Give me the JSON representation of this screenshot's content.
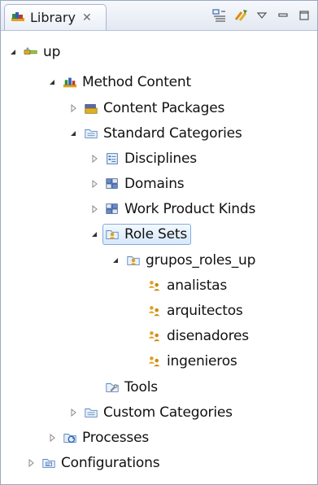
{
  "view": {
    "tab_label": "Library",
    "tab_close_glyph": "✕",
    "toolbar": [
      {
        "name": "link-with-editor-icon"
      },
      {
        "name": "sync-icon"
      },
      {
        "name": "view-menu-icon"
      },
      {
        "name": "minimize-icon"
      },
      {
        "name": "maximize-icon"
      }
    ]
  },
  "tree": {
    "nodes": [
      {
        "label": "up",
        "icon": "plugin-icon",
        "expanded": true
      },
      {
        "label": "Method Content",
        "icon": "method-content-icon",
        "expanded": true
      },
      {
        "label": "Content Packages",
        "icon": "content-packages-icon",
        "expanded": false
      },
      {
        "label": "Standard Categories",
        "icon": "category-folder-icon",
        "expanded": true
      },
      {
        "label": "Disciplines",
        "icon": "disciplines-icon",
        "expanded": false
      },
      {
        "label": "Domains",
        "icon": "domains-icon",
        "expanded": false
      },
      {
        "label": "Work Product Kinds",
        "icon": "work-product-kinds-icon",
        "expanded": false
      },
      {
        "label": "Role Sets",
        "icon": "role-sets-icon",
        "expanded": true,
        "selected": true
      },
      {
        "label": "grupos_roles_up",
        "icon": "role-set-icon",
        "expanded": true
      },
      {
        "label": "analistas",
        "icon": "role-group-icon"
      },
      {
        "label": "arquitectos",
        "icon": "role-group-icon"
      },
      {
        "label": "disenadores",
        "icon": "role-group-icon"
      },
      {
        "label": "ingenieros",
        "icon": "role-group-icon"
      },
      {
        "label": "Tools",
        "icon": "tools-icon"
      },
      {
        "label": "Custom Categories",
        "icon": "category-folder-icon",
        "expanded": false
      },
      {
        "label": "Processes",
        "icon": "processes-icon",
        "expanded": false
      },
      {
        "label": "Configurations",
        "icon": "configurations-icon",
        "expanded": false
      }
    ]
  },
  "colors": {
    "selection_border": "#84acdd",
    "selection_fill": "#d6e8fb",
    "panel_border": "#99a8c1"
  }
}
